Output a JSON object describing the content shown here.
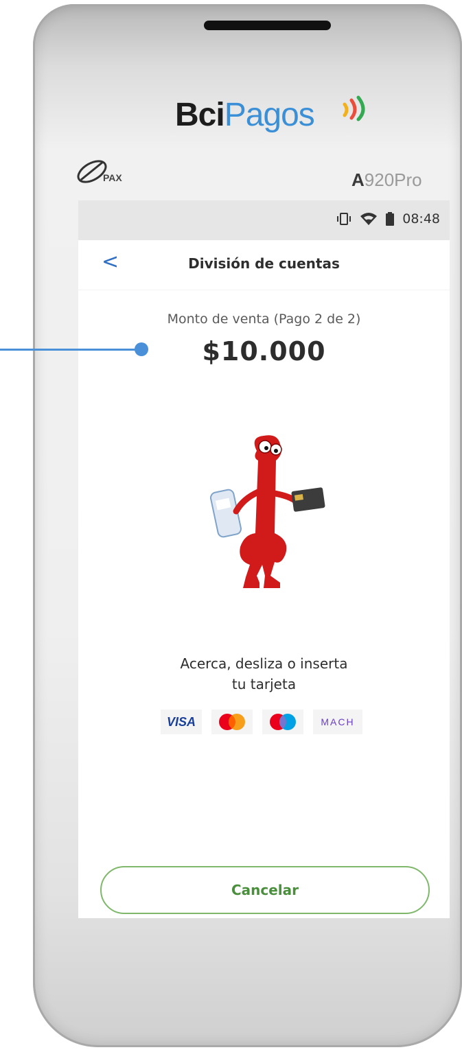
{
  "device": {
    "brand_left": "Bci",
    "brand_right": "Pagos",
    "manufacturer": "PAX",
    "model_prefix": "A",
    "model_suffix": "920Pro"
  },
  "statusbar": {
    "time": "08:48"
  },
  "appbar": {
    "back_icon": "<",
    "title": "División de cuentas"
  },
  "payment": {
    "amount_label": "Monto de venta (Pago 2 de 2)",
    "amount": "$10.000"
  },
  "prompt": {
    "line1": "Acerca, desliza o inserta",
    "line2": "tu tarjeta"
  },
  "card_brands": {
    "visa": "VISA",
    "mach": "MACH"
  },
  "actions": {
    "cancel_label": "Cancelar"
  },
  "colors": {
    "accent_blue": "#3a8fd6",
    "cancel_green": "#4a8f3c",
    "callout_blue": "#4a90d9"
  }
}
